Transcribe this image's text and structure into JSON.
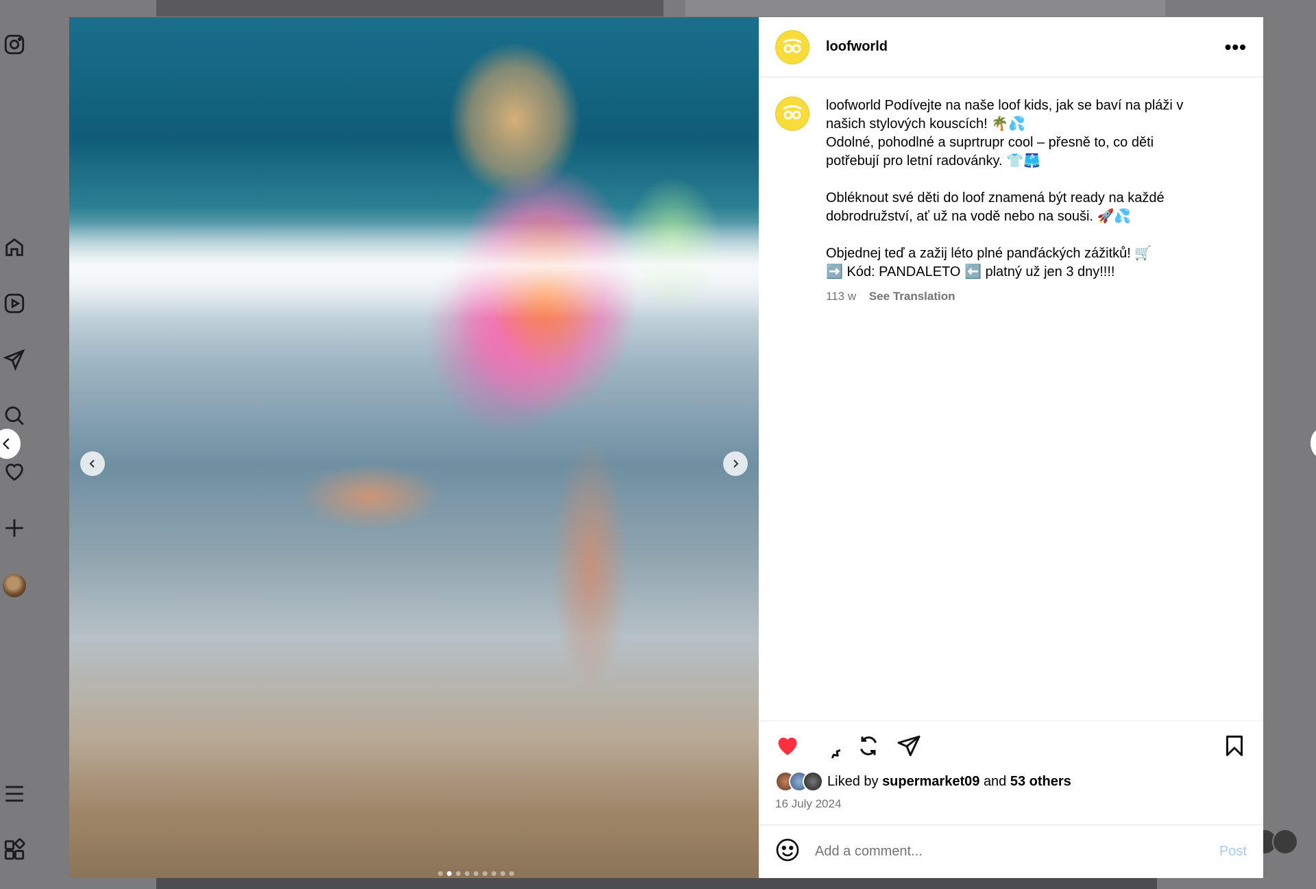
{
  "post": {
    "username": "loofworld",
    "more_label": "•••",
    "caption_user": "loofworld",
    "caption_text": "Podívejte na naše loof kids, jak se baví na pláži v našich stylových kouscích! 🌴💦\nOdolné, pohodlné a suprtrupr cool – přesně to, co děti potřebují pro letní radovánky. 👕🩳\n\nObléknout své děti do loof znamená být ready na každé dobrodružství, ať už na vodě nebo na souši. 🚀💦\n\nObjednej teď a zažij léto plné panďáckých zážitků! 🛒\n➡️ Kód: PANDALETO ⬅️ platný už jen 3 dny!!!!",
    "age": "113 w",
    "see_translation": "See Translation",
    "liked_by_prefix": "Liked by",
    "liked_by_user": "supermarket09",
    "liked_by_and": "and",
    "liked_by_others": "53 others",
    "date": "16 July 2024",
    "liked": true,
    "carousel": {
      "count": 9,
      "active_index": 1
    }
  },
  "comment": {
    "placeholder": "Add a comment...",
    "post_label": "Post"
  },
  "colors": {
    "like_red": "#ff3040",
    "logo_yellow": "#f7dc3a",
    "post_button": "#a8c9f5"
  },
  "icons": {
    "rail": [
      "instagram-icon",
      "home-icon",
      "reels-icon",
      "direct-icon",
      "search-icon",
      "heart-icon",
      "create-icon",
      "profile-avatar",
      "menu-icon",
      "more-apps-icon"
    ],
    "actions": [
      "heart-icon",
      "comment-icon",
      "repost-icon",
      "share-icon",
      "bookmark-icon"
    ]
  }
}
